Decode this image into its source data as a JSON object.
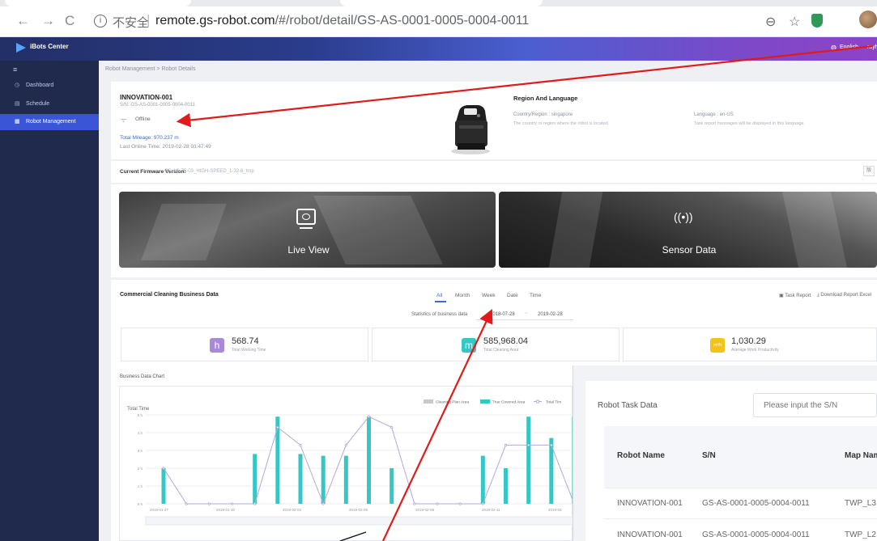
{
  "browser": {
    "back_icon": "arrow-left-icon",
    "forward_icon": "arrow-right-icon",
    "reload_icon": "reload-icon",
    "insecure_label": "不安全",
    "url_domain": "remote.gs-robot.com",
    "url_path": "/#/robot/detail/GS-AS-0001-0005-0004-0011"
  },
  "header": {
    "app_name": "iBots Center",
    "language": "English",
    "user": "rayh"
  },
  "sidebar": {
    "items": [
      {
        "label": "Dashboard",
        "icon": "clock-icon"
      },
      {
        "label": "Schedule",
        "icon": "calendar-icon"
      },
      {
        "label": "Robot Management",
        "icon": "robot-icon",
        "active": true
      }
    ]
  },
  "breadcrumb": "Robot Management  >  Robot Details",
  "robot": {
    "name": "INNOVATION-001",
    "sn": "S/N: GS-AS-0001-0005-0004-0011",
    "status": "Offline",
    "mileage": "Total Mileage: 970.237 m",
    "last_online": "Last Online Time: 2019-02-28 03:47:49"
  },
  "region": {
    "title": "Region And Language",
    "country_label": "Country/Region :  singapore",
    "country_desc": "The country or region where the robot is located.",
    "language_label": "Language :  en-US",
    "language_desc": "Task report messages will be displayed in this language."
  },
  "firmware": {
    "label": "Current Firmware Version:",
    "value": "GS-AS-75-03_HIGH-SPEED_1-32-6_tmp",
    "button": "版"
  },
  "media": {
    "live_label": "Live View",
    "sensor_label": "Sensor Data"
  },
  "business": {
    "title": "Commercial Cleaning Business Data",
    "tabs": [
      "All",
      "Month",
      "Week",
      "Date",
      "Time"
    ],
    "task_report": "Task Report",
    "download_report": "Download Report Excel",
    "stats_label": "Statistics of business data",
    "date_start": "2018-07-28",
    "date_sep": "~",
    "date_end": "2019-02-28",
    "stats": [
      {
        "icon": "h",
        "value": "568.74",
        "label": "Total Working Time",
        "color": "#a98ad9"
      },
      {
        "icon": "m",
        "value": "585,968.04",
        "label": "Total Cleaning Area",
        "color": "#35c6c6"
      },
      {
        "icon": "m²/h",
        "value": "1,030.29",
        "label": "Average Work Productivity",
        "color": "#f4c21b"
      }
    ],
    "chart_label": "Business Data Chart"
  },
  "chart_data": {
    "type": "bar",
    "ylabel": "Total Time",
    "yticks": [
      "0 h",
      "1 h",
      "2 h",
      "3 h",
      "4 h",
      "5 h"
    ],
    "ylim": [
      0,
      5
    ],
    "xticks": [
      "2019-01-27",
      "2019-01-30",
      "2019-02-02",
      "2019-02-05",
      "2019-02-08",
      "2019-02-11",
      "2019-02"
    ],
    "legend": [
      "Cleaning Plan Area",
      "True Covered Area",
      "Total Tim"
    ],
    "colors": {
      "plan": "#c9c9c9",
      "covered": "#35c6c6",
      "line": "#b4a7db"
    },
    "bars": [
      2.0,
      0,
      0,
      0,
      2.8,
      4.9,
      2.8,
      2.7,
      2.7,
      4.9,
      2.0,
      0,
      0,
      0,
      2.7,
      2.0,
      4.9,
      3.7,
      4.9
    ],
    "line": [
      2.0,
      0,
      0,
      0,
      0,
      4.3,
      3.3,
      0,
      3.3,
      4.9,
      4.3,
      0,
      0,
      0,
      0,
      3.3,
      3.3,
      3.3,
      0
    ]
  },
  "task_data": {
    "title": "Robot Task Data",
    "search_placeholder": "Please input the S/N",
    "headers": [
      "Robot Name",
      "S/N",
      "Map Name"
    ],
    "rows": [
      [
        "INNOVATION-001",
        "GS-AS-0001-0005-0004-0011",
        "TWP_L3"
      ],
      [
        "INNOVATION-001",
        "GS-AS-0001-0005-0004-0011",
        "TWP_L2"
      ]
    ]
  },
  "annotations": {
    "arrow_color": "#e11b1b"
  }
}
